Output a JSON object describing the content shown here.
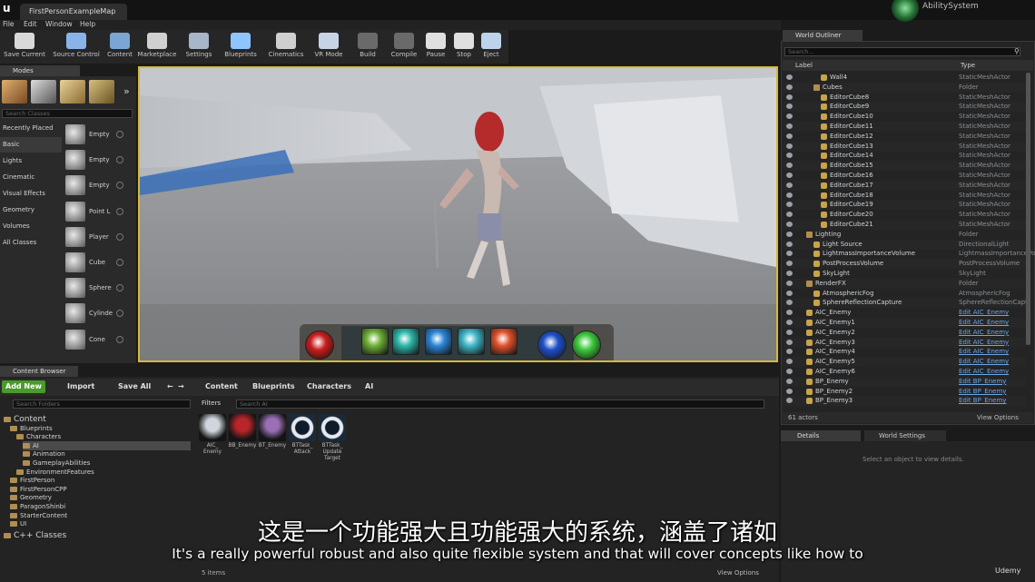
{
  "window": {
    "tab_title": "FirstPersonExampleMap",
    "project_name": "AbilitySystem",
    "logo": "ue-logo"
  },
  "menu": [
    "File",
    "Edit",
    "Window",
    "Help"
  ],
  "toolbar": [
    {
      "label": "Save Current",
      "icon": "save-icon",
      "color": "#d9d9d9"
    },
    {
      "label": "Source Control",
      "icon": "source-control-icon",
      "color": "#8ab4e8"
    },
    {
      "label": "Content",
      "icon": "content-icon",
      "color": "#7aa6d6"
    },
    {
      "label": "Marketplace",
      "icon": "marketplace-icon",
      "color": "#d0d0d0"
    },
    {
      "label": "Settings",
      "icon": "settings-icon",
      "color": "#a7b6c8"
    },
    {
      "label": "Blueprints",
      "icon": "blueprints-icon",
      "color": "#8ec5ff"
    },
    {
      "label": "Cinematics",
      "icon": "cinematics-icon",
      "color": "#cfcfcf"
    },
    {
      "label": "VR Mode",
      "icon": "vr-icon",
      "color": "#c6d4e6"
    },
    {
      "label": "Build",
      "icon": "build-icon",
      "color": "#6a6a6a"
    },
    {
      "label": "Compile",
      "icon": "compile-icon",
      "color": "#6a6a6a"
    },
    {
      "label": "Pause",
      "icon": "pause-icon",
      "color": "#e0e0e0"
    },
    {
      "label": "Stop",
      "icon": "stop-icon",
      "color": "#e0e0e0"
    },
    {
      "label": "Eject",
      "icon": "eject-icon",
      "color": "#bcd3ea"
    }
  ],
  "modes": {
    "tab": "Modes",
    "search_placeholder": "Search Classes",
    "categories": [
      "Recently Placed",
      "Basic",
      "Lights",
      "Cinematic",
      "Visual Effects",
      "Geometry",
      "Volumes",
      "All Classes"
    ],
    "items": [
      "Empty",
      "Empty",
      "Empty",
      "Point L",
      "Player",
      "Cube",
      "Sphere",
      "Cylinde",
      "Cone"
    ]
  },
  "world_outliner": {
    "tab": "World Outliner",
    "search_placeholder": "Search...",
    "col_label": "Label",
    "col_type": "Type",
    "rows": [
      {
        "label": "Wall4",
        "type": "StaticMeshActor",
        "indent": 3
      },
      {
        "label": "Cubes",
        "type": "Folder",
        "indent": 2,
        "folder": true
      },
      {
        "label": "EditorCube8",
        "type": "StaticMeshActor",
        "indent": 3
      },
      {
        "label": "EditorCube9",
        "type": "StaticMeshActor",
        "indent": 3
      },
      {
        "label": "EditorCube10",
        "type": "StaticMeshActor",
        "indent": 3
      },
      {
        "label": "EditorCube11",
        "type": "StaticMeshActor",
        "indent": 3
      },
      {
        "label": "EditorCube12",
        "type": "StaticMeshActor",
        "indent": 3
      },
      {
        "label": "EditorCube13",
        "type": "StaticMeshActor",
        "indent": 3
      },
      {
        "label": "EditorCube14",
        "type": "StaticMeshActor",
        "indent": 3
      },
      {
        "label": "EditorCube15",
        "type": "StaticMeshActor",
        "indent": 3
      },
      {
        "label": "EditorCube16",
        "type": "StaticMeshActor",
        "indent": 3
      },
      {
        "label": "EditorCube17",
        "type": "StaticMeshActor",
        "indent": 3
      },
      {
        "label": "EditorCube18",
        "type": "StaticMeshActor",
        "indent": 3
      },
      {
        "label": "EditorCube19",
        "type": "StaticMeshActor",
        "indent": 3
      },
      {
        "label": "EditorCube20",
        "type": "StaticMeshActor",
        "indent": 3
      },
      {
        "label": "EditorCube21",
        "type": "StaticMeshActor",
        "indent": 3
      },
      {
        "label": "Lighting",
        "type": "Folder",
        "indent": 1,
        "folder": true
      },
      {
        "label": "Light Source",
        "type": "DirectionalLight",
        "indent": 2
      },
      {
        "label": "LightmassImportanceVolume",
        "type": "LightmassImportanceVol",
        "indent": 2
      },
      {
        "label": "PostProcessVolume",
        "type": "PostProcessVolume",
        "indent": 2
      },
      {
        "label": "SkyLight",
        "type": "SkyLight",
        "indent": 2
      },
      {
        "label": "RenderFX",
        "type": "Folder",
        "indent": 1,
        "folder": true
      },
      {
        "label": "AtmosphericFog",
        "type": "AtmosphericFog",
        "indent": 2
      },
      {
        "label": "SphereReflectionCapture",
        "type": "SphereReflectionCapt",
        "indent": 2
      },
      {
        "label": "AIC_Enemy",
        "type": "Edit AIC_Enemy",
        "indent": 1,
        "link": true
      },
      {
        "label": "AIC_Enemy1",
        "type": "Edit AIC_Enemy",
        "indent": 1,
        "link": true
      },
      {
        "label": "AIC_Enemy2",
        "type": "Edit AIC_Enemy",
        "indent": 1,
        "link": true
      },
      {
        "label": "AIC_Enemy3",
        "type": "Edit AIC_Enemy",
        "indent": 1,
        "link": true
      },
      {
        "label": "AIC_Enemy4",
        "type": "Edit AIC_Enemy",
        "indent": 1,
        "link": true
      },
      {
        "label": "AIC_Enemy5",
        "type": "Edit AIC_Enemy",
        "indent": 1,
        "link": true
      },
      {
        "label": "AIC_Enemy6",
        "type": "Edit AIC_Enemy",
        "indent": 1,
        "link": true
      },
      {
        "label": "BP_Enemy",
        "type": "Edit BP_Enemy",
        "indent": 1,
        "link": true
      },
      {
        "label": "BP_Enemy2",
        "type": "Edit BP_Enemy",
        "indent": 1,
        "link": true
      },
      {
        "label": "BP_Enemy3",
        "type": "Edit BP_Enemy",
        "indent": 1,
        "link": true
      }
    ],
    "actor_count": "61 actors",
    "view_options": "View Options"
  },
  "details": {
    "tab": "Details",
    "world_settings_tab": "World Settings",
    "empty_text": "Select an object to view details."
  },
  "content_browser": {
    "tab": "Content Browser",
    "add_new": "Add New",
    "import": "Import",
    "save_all": "Save All",
    "breadcrumb": [
      "Content",
      "Blueprints",
      "Characters",
      "AI"
    ],
    "folder_search_placeholder": "Search Folders",
    "filters": "Filters",
    "asset_search_placeholder": "Search AI",
    "tree": [
      {
        "label": "Content",
        "level": 0
      },
      {
        "label": "Blueprints",
        "level": 1
      },
      {
        "label": "Characters",
        "level": 2
      },
      {
        "label": "AI",
        "level": 3,
        "selected": true
      },
      {
        "label": "Animation",
        "level": 3
      },
      {
        "label": "GameplayAbilities",
        "level": 3
      },
      {
        "label": "EnvironmentFeatures",
        "level": 2
      },
      {
        "label": "FirstPerson",
        "level": 1
      },
      {
        "label": "FirstPersonCPP",
        "level": 1
      },
      {
        "label": "Geometry",
        "level": 1
      },
      {
        "label": "ParagonShinbi",
        "level": 1
      },
      {
        "label": "StarterContent",
        "level": 1
      },
      {
        "label": "UI",
        "level": 1
      },
      {
        "label": "C++ Classes",
        "level": 0
      }
    ],
    "assets": [
      {
        "label": "AIC_ Enemy",
        "thumb_color": "#cfd6de"
      },
      {
        "label": "BB_Enemy",
        "thumb_color": "#b8252a"
      },
      {
        "label": "BT_Enemy",
        "thumb_color": "#9a6fb6"
      },
      {
        "label": "BTTask_ Attack",
        "thumb_color": "#e6e9ef"
      },
      {
        "label": "BTTask_ Update Target",
        "thumb_color": "#e6e9ef"
      }
    ],
    "items_count": "5 items",
    "view_options": "View Options"
  },
  "hud_slots": [
    {
      "color": "#c81e1e",
      "round": true
    },
    {
      "color": "#6fb036",
      "round": false
    },
    {
      "color": "#2cb7a8",
      "round": false
    },
    {
      "color": "#2c86d6",
      "round": false
    },
    {
      "color": "#3fb6c8",
      "round": false
    },
    {
      "color": "#e0522c",
      "round": false
    },
    {
      "color": "#1e4fc8",
      "round": true
    },
    {
      "color": "#3cc83c",
      "round": true
    }
  ],
  "subtitles": {
    "cn": "这是一个功能强大且功能强大的系统，涵盖了诸如",
    "en": "It's a really powerful robust and also quite flexible system and that will cover concepts like how to"
  },
  "watermark": "Udemy"
}
